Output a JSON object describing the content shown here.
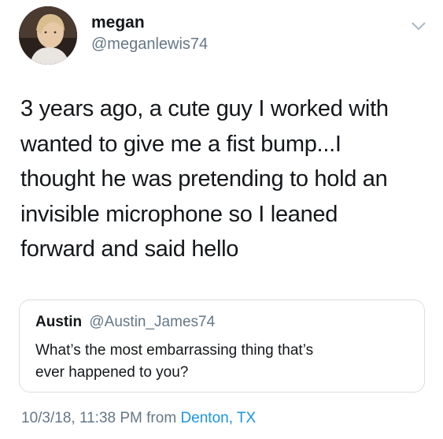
{
  "author": {
    "name": "megan",
    "handle": "@meganlewis74",
    "avatar_icon": "profile-photo"
  },
  "menu_icon": "chevron-down-icon",
  "tweet": {
    "lines": [
      "3 years ago, a cute guy I worked with",
      "wanted to give me a fist bump...I",
      "thought he was pretending to hold an",
      "invisible microphone so I leaned",
      "forward and said hello"
    ]
  },
  "quoted_tweet": {
    "name": "Austin",
    "handle": "@Austin_James74",
    "lines": [
      "What’s the most embarrassing thing that’s",
      "ever happened to you?"
    ]
  },
  "meta": {
    "timestamp": "10/3/18, 11:38 PM",
    "from_label": "from",
    "location": "Denton, TX"
  },
  "colors": {
    "text": "#14171a",
    "secondary": "#657786",
    "link": "#1b95e0",
    "border": "#d8dee3"
  }
}
